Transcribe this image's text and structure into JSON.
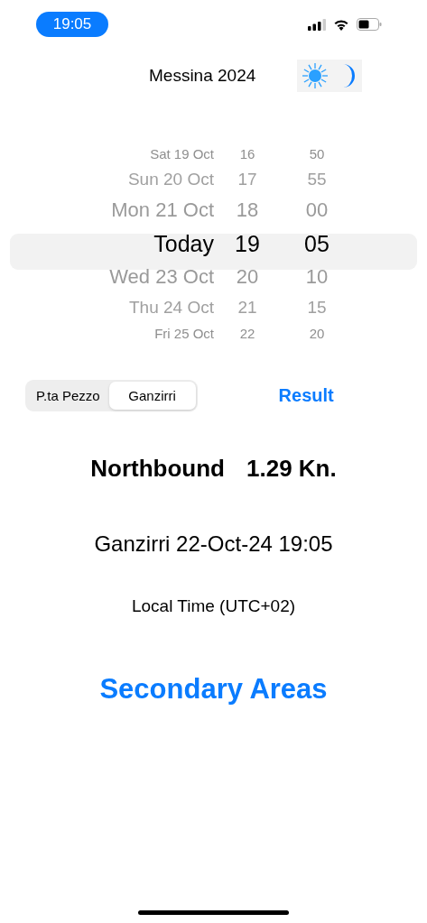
{
  "status_bar": {
    "time": "19:05"
  },
  "title": "Messina 2024",
  "picker": {
    "rows": [
      {
        "date": "Sat 19 Oct",
        "hour": "16",
        "minute": "50",
        "selected": false
      },
      {
        "date": "Sun 20 Oct",
        "hour": "17",
        "minute": "55",
        "selected": false
      },
      {
        "date": "Mon 21 Oct",
        "hour": "18",
        "minute": "00",
        "selected": false
      },
      {
        "date": "Today",
        "hour": "19",
        "minute": "05",
        "selected": true
      },
      {
        "date": "Wed 23 Oct",
        "hour": "20",
        "minute": "10",
        "selected": false
      },
      {
        "date": "Thu 24 Oct",
        "hour": "21",
        "minute": "15",
        "selected": false
      },
      {
        "date": "Fri 25 Oct",
        "hour": "22",
        "minute": "20",
        "selected": false
      }
    ]
  },
  "segments": [
    {
      "label": "P.ta Pezzo",
      "selected": false
    },
    {
      "label": "Ganzirri",
      "selected": true
    }
  ],
  "result_button": "Result",
  "direction": "Northbound",
  "speed": "1.29 Kn.",
  "location_time": "Ganzirri 22-Oct-24 19:05",
  "timezone": "Local Time (UTC+02)",
  "secondary_link": "Secondary Areas"
}
